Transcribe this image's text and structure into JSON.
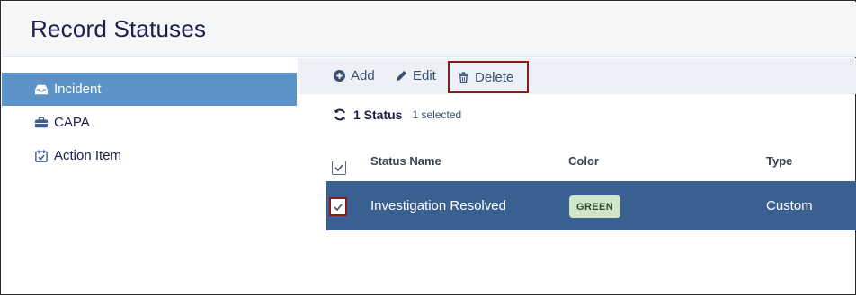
{
  "page": {
    "title": "Record Statuses"
  },
  "sidebar": {
    "items": [
      {
        "label": "Incident",
        "icon": "inbox-icon",
        "active": true
      },
      {
        "label": "CAPA",
        "icon": "briefcase-icon",
        "active": false
      },
      {
        "label": "Action Item",
        "icon": "calendar-check-icon",
        "active": false
      }
    ]
  },
  "toolbar": {
    "add_label": "Add",
    "edit_label": "Edit",
    "delete_label": "Delete"
  },
  "status_line": {
    "count_text": "1 Status",
    "selected_text": "1 selected"
  },
  "table": {
    "columns": [
      "Status Name",
      "Color",
      "Type"
    ],
    "rows": [
      {
        "name": "Investigation Resolved",
        "color": "GREEN",
        "type": "Custom",
        "selected": true
      }
    ]
  },
  "colors": {
    "sidebar_active": "#5b93c9",
    "row_selected": "#3a6091",
    "badge_green": "#cfe6c9",
    "highlight_border": "#8b1a1a"
  }
}
